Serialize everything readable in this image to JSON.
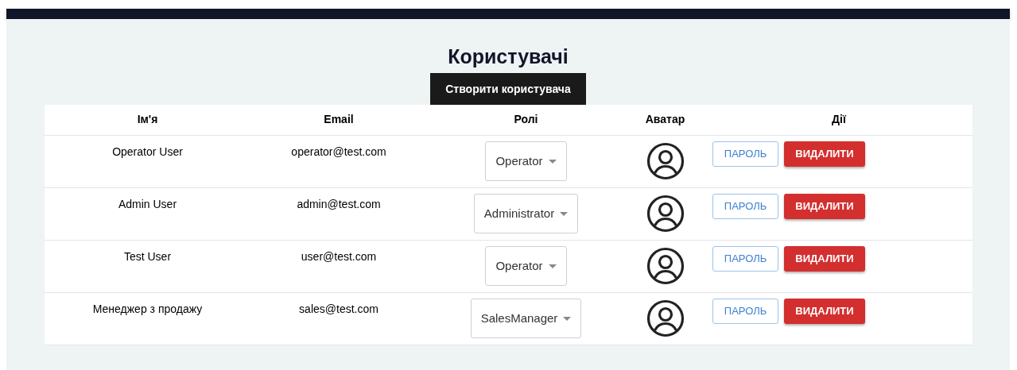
{
  "title": "Користувачі",
  "create_button": "Створити користувача",
  "table": {
    "columns": [
      "Ім'я",
      "Email",
      "Ролі",
      "Аватар",
      "Дії"
    ],
    "rows": [
      {
        "name": "Operator User",
        "email": "operator@test.com",
        "role": "Operator",
        "password_button": "ПАРОЛЬ",
        "delete_button": "ВИДАЛИТИ"
      },
      {
        "name": "Admin User",
        "email": "admin@test.com",
        "role": "Administrator",
        "password_button": "ПАРОЛЬ",
        "delete_button": "ВИДАЛИТИ"
      },
      {
        "name": "Test User",
        "email": "user@test.com",
        "role": "Operator",
        "password_button": "ПАРОЛЬ",
        "delete_button": "ВИДАЛИТИ"
      },
      {
        "name": "Менеджер з продажу",
        "email": "sales@test.com",
        "role": "SalesManager",
        "password_button": "ПАРОЛЬ",
        "delete_button": "ВИДАЛИТИ"
      }
    ]
  }
}
